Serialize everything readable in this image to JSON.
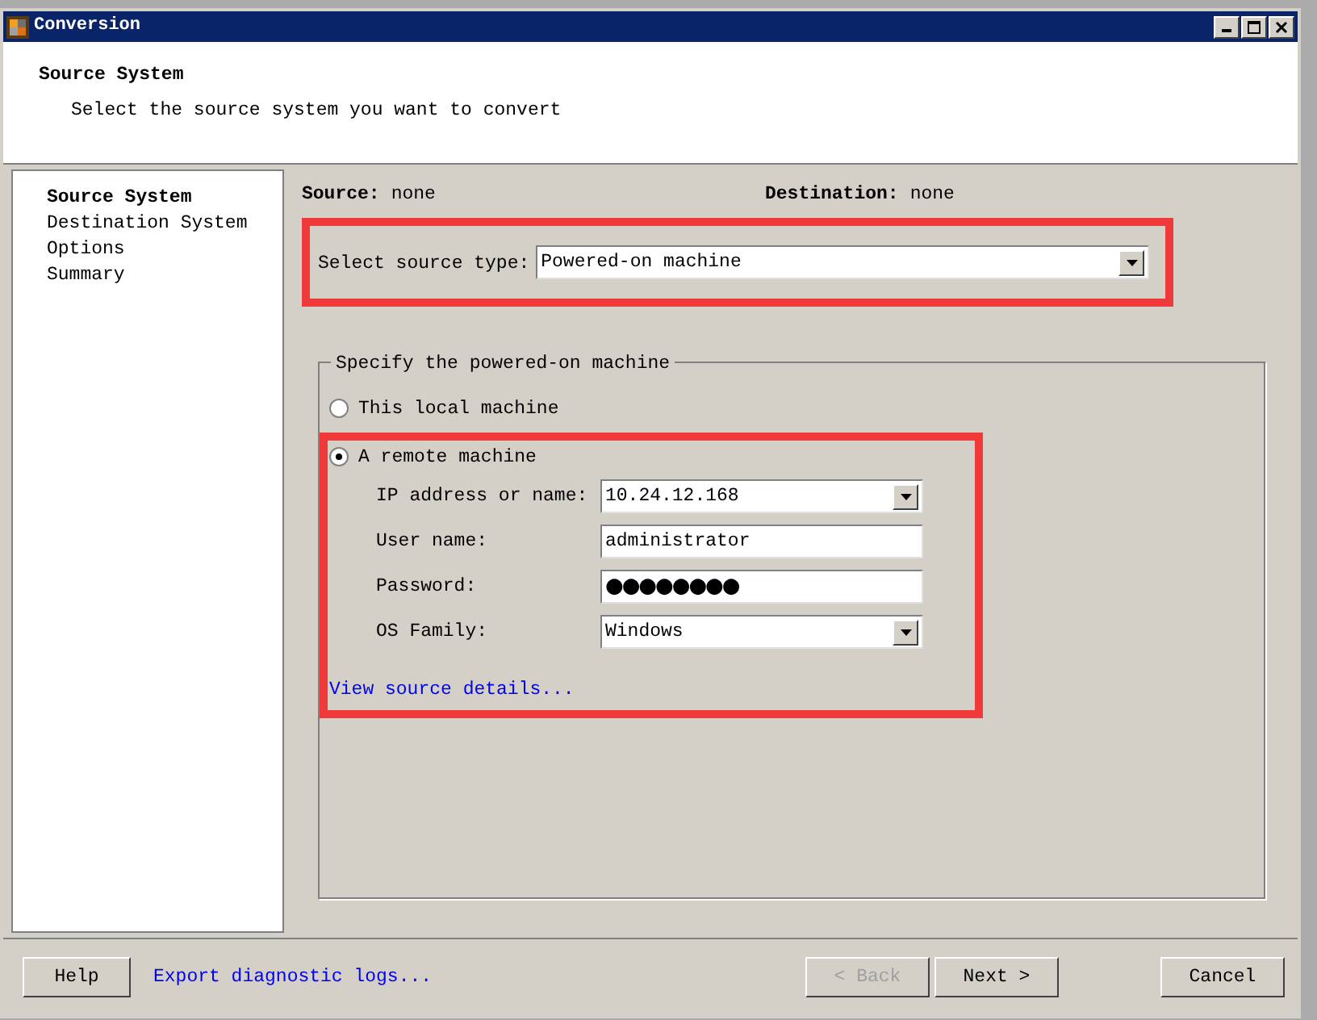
{
  "window": {
    "title": "Conversion"
  },
  "header": {
    "title": "Source System",
    "subtitle": "Select the source system you want to convert"
  },
  "steps": [
    {
      "label": "Source System",
      "selected": true
    },
    {
      "label": "Destination System",
      "selected": false
    },
    {
      "label": "Options",
      "selected": false
    },
    {
      "label": "Summary",
      "selected": false
    }
  ],
  "summary": [
    {
      "label": "Source:",
      "value": "none"
    },
    {
      "label": "Destination:",
      "value": "none"
    }
  ],
  "source_type": {
    "label": "Select source type:",
    "value": "Powered-on machine"
  },
  "group": {
    "title": "Specify the powered-on machine",
    "options": [
      {
        "label": "This local machine",
        "selected": false
      },
      {
        "label": "A remote machine",
        "selected": true
      }
    ],
    "fields": [
      {
        "kind": "combo",
        "label": "IP address or name:",
        "value": "10.24.12.168"
      },
      {
        "kind": "text",
        "label": "User name:",
        "value": "administrator"
      },
      {
        "kind": "password",
        "label": "Password:",
        "value": "●●●●●●●●"
      },
      {
        "kind": "combo",
        "label": "OS Family:",
        "value": "Windows"
      }
    ],
    "link": "View source details..."
  },
  "footer": {
    "help": "Help",
    "export_link": "Export diagnostic logs...",
    "buttons": [
      {
        "label": "< Back",
        "disabled": true
      },
      {
        "label": "Next >",
        "disabled": false
      },
      {
        "label": "Cancel",
        "disabled": false
      }
    ]
  }
}
